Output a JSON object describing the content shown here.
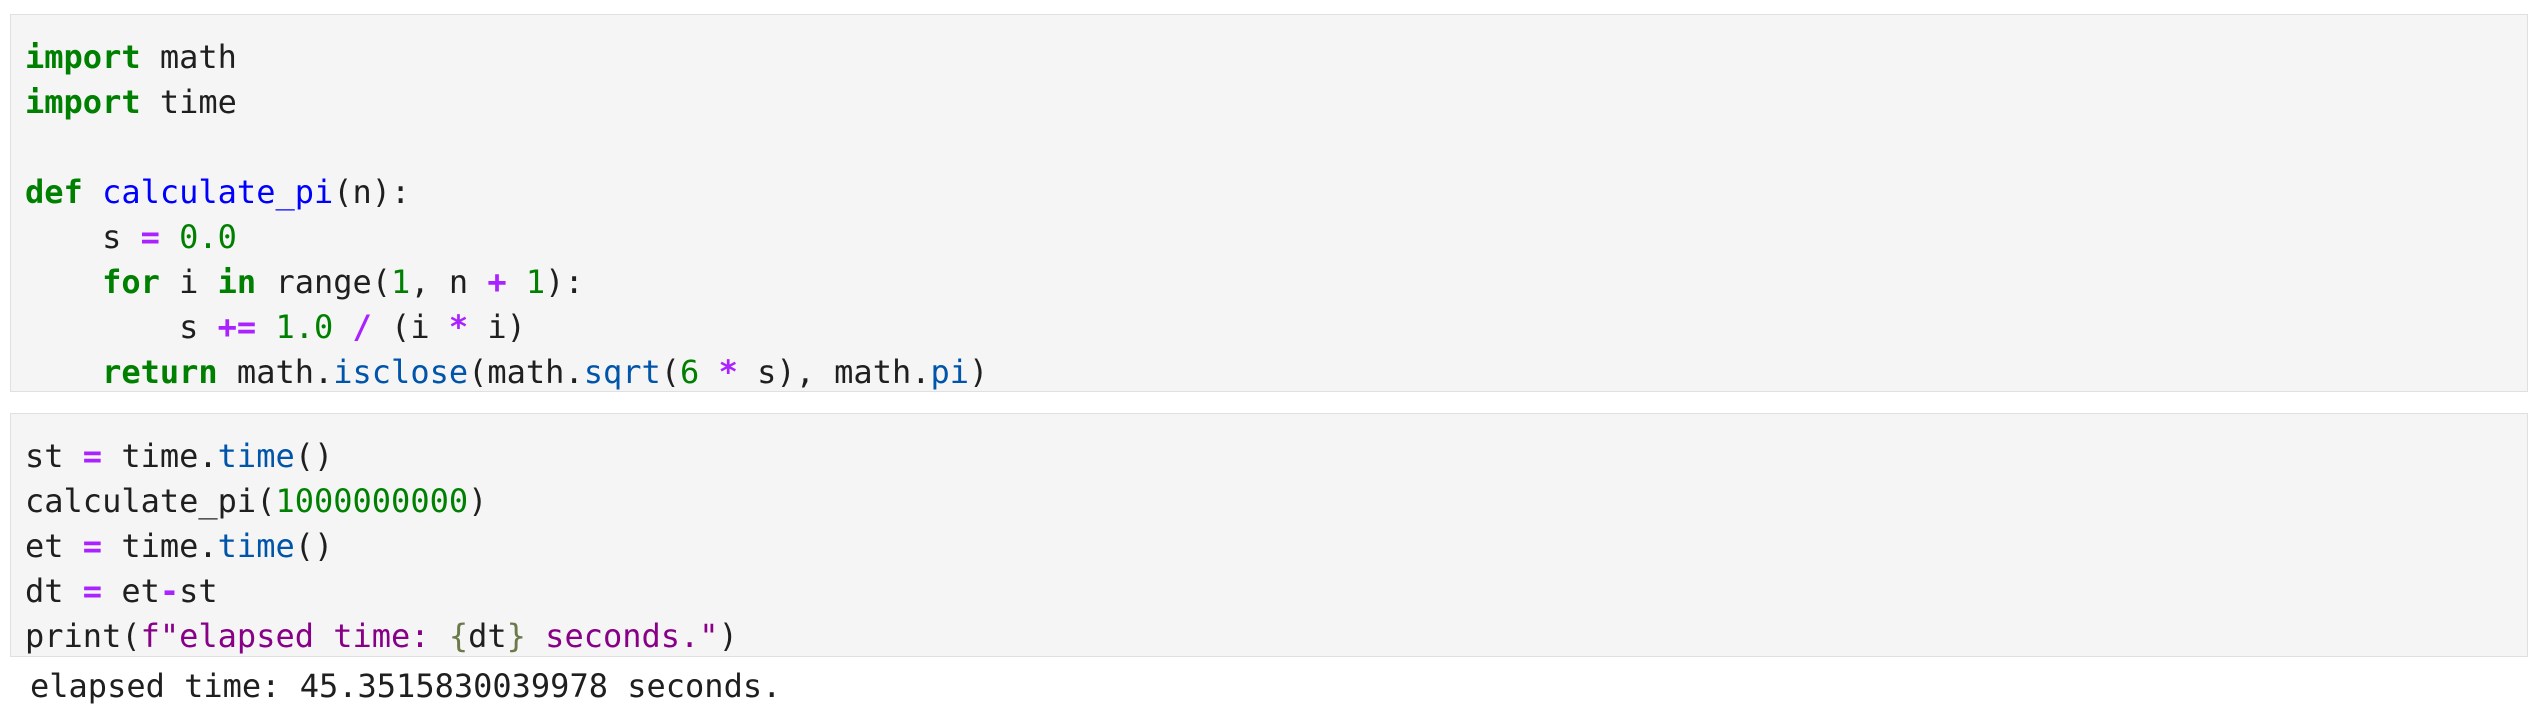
{
  "cells": [
    {
      "type": "code",
      "lines": [
        {
          "tokens": [
            {
              "t": "import",
              "c": "kw"
            },
            {
              "t": " math",
              "c": ""
            }
          ]
        },
        {
          "tokens": [
            {
              "t": "import",
              "c": "kw"
            },
            {
              "t": " time",
              "c": ""
            }
          ]
        },
        {
          "tokens": []
        },
        {
          "tokens": [
            {
              "t": "def",
              "c": "kw"
            },
            {
              "t": " ",
              "c": ""
            },
            {
              "t": "calculate_pi",
              "c": "fn"
            },
            {
              "t": "(n):",
              "c": ""
            }
          ]
        },
        {
          "tokens": [
            {
              "t": "    s ",
              "c": ""
            },
            {
              "t": "=",
              "c": "op"
            },
            {
              "t": " ",
              "c": ""
            },
            {
              "t": "0.0",
              "c": "num"
            }
          ]
        },
        {
          "tokens": [
            {
              "t": "    ",
              "c": ""
            },
            {
              "t": "for",
              "c": "kw"
            },
            {
              "t": " i ",
              "c": ""
            },
            {
              "t": "in",
              "c": "kw"
            },
            {
              "t": " range(",
              "c": ""
            },
            {
              "t": "1",
              "c": "num"
            },
            {
              "t": ", n ",
              "c": ""
            },
            {
              "t": "+",
              "c": "op"
            },
            {
              "t": " ",
              "c": ""
            },
            {
              "t": "1",
              "c": "num"
            },
            {
              "t": "):",
              "c": ""
            }
          ]
        },
        {
          "tokens": [
            {
              "t": "        s ",
              "c": ""
            },
            {
              "t": "+=",
              "c": "op"
            },
            {
              "t": " ",
              "c": ""
            },
            {
              "t": "1.0",
              "c": "num"
            },
            {
              "t": " ",
              "c": ""
            },
            {
              "t": "/",
              "c": "op"
            },
            {
              "t": " (i ",
              "c": ""
            },
            {
              "t": "*",
              "c": "op"
            },
            {
              "t": " i)",
              "c": ""
            }
          ]
        },
        {
          "tokens": [
            {
              "t": "    ",
              "c": ""
            },
            {
              "t": "return",
              "c": "kw"
            },
            {
              "t": " math.",
              "c": ""
            },
            {
              "t": "isclose",
              "c": "attr"
            },
            {
              "t": "(math.",
              "c": ""
            },
            {
              "t": "sqrt",
              "c": "attr"
            },
            {
              "t": "(",
              "c": ""
            },
            {
              "t": "6",
              "c": "num"
            },
            {
              "t": " ",
              "c": ""
            },
            {
              "t": "*",
              "c": "op"
            },
            {
              "t": " s), math.",
              "c": ""
            },
            {
              "t": "pi",
              "c": "attr"
            },
            {
              "t": ")",
              "c": ""
            }
          ]
        }
      ]
    },
    {
      "type": "code",
      "lines": [
        {
          "tokens": [
            {
              "t": "st ",
              "c": ""
            },
            {
              "t": "=",
              "c": "op"
            },
            {
              "t": " time.",
              "c": ""
            },
            {
              "t": "time",
              "c": "attr"
            },
            {
              "t": "()",
              "c": ""
            }
          ]
        },
        {
          "tokens": [
            {
              "t": "calculate_pi(",
              "c": ""
            },
            {
              "t": "1000000000",
              "c": "num"
            },
            {
              "t": ")",
              "c": ""
            }
          ]
        },
        {
          "tokens": [
            {
              "t": "et ",
              "c": ""
            },
            {
              "t": "=",
              "c": "op"
            },
            {
              "t": " time.",
              "c": ""
            },
            {
              "t": "time",
              "c": "attr"
            },
            {
              "t": "()",
              "c": ""
            }
          ]
        },
        {
          "tokens": [
            {
              "t": "dt ",
              "c": ""
            },
            {
              "t": "=",
              "c": "op"
            },
            {
              "t": " et",
              "c": ""
            },
            {
              "t": "-",
              "c": "op"
            },
            {
              "t": "st",
              "c": ""
            }
          ]
        },
        {
          "tokens": [
            {
              "t": "print(",
              "c": ""
            },
            {
              "t": "f\"elapsed time: ",
              "c": "str"
            },
            {
              "t": "{",
              "c": "interp"
            },
            {
              "t": "dt",
              "c": ""
            },
            {
              "t": "}",
              "c": "interp"
            },
            {
              "t": " seconds.\"",
              "c": "str"
            },
            {
              "t": ")",
              "c": ""
            }
          ]
        }
      ]
    }
  ],
  "output": {
    "text": "elapsed time: 45.3515830039978 seconds."
  }
}
